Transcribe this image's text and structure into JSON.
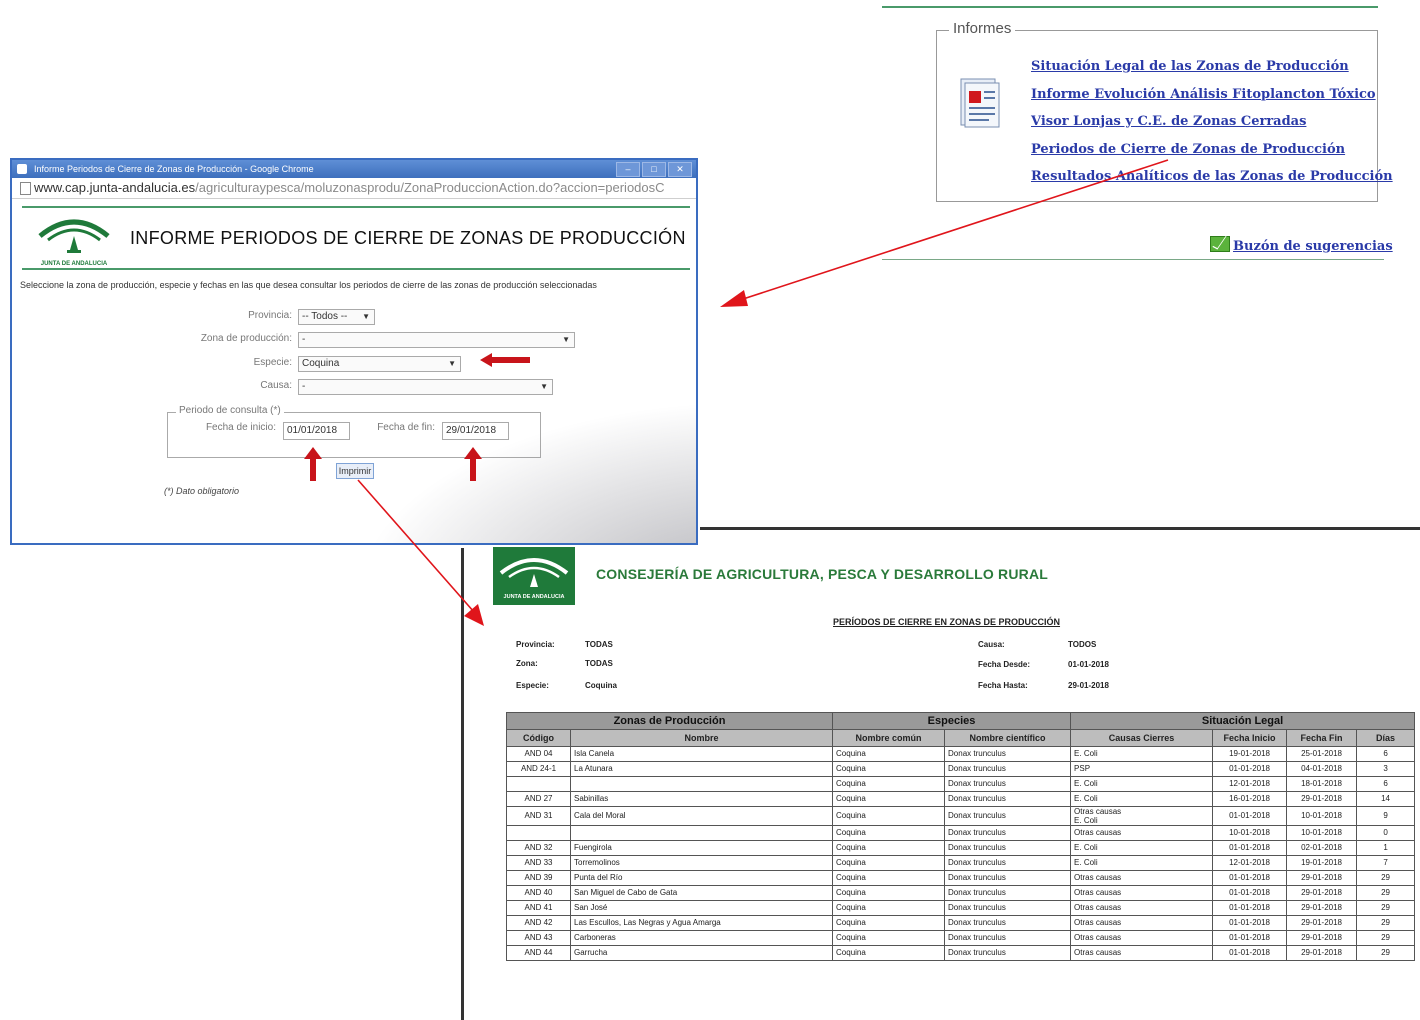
{
  "informes": {
    "legend": "Informes",
    "links": [
      "Situación Legal de las Zonas de Producción",
      "Informe Evolución Análisis Fitoplancton Tóxico",
      "Visor Lonjas y C.E. de Zonas Cerradas",
      "Periodos de Cierre de Zonas de Producción",
      "Resultados Analíticos de las Zonas de Producción"
    ],
    "buzon": "Buzón de sugerencias"
  },
  "browser": {
    "window_title": "Informe Periodos de Cierre de Zonas de Producción - Google Chrome",
    "url_host": "www.cap.junta-andalucia.es",
    "url_path": "/agriculturaypesca/moluzonasprodu/ZonaProduccionAction.do?accion=periodosC",
    "logo_text": "JUNTA DE ANDALUCIA",
    "app_title": "INFORME PERIODOS DE CIERRE DE ZONAS DE PRODUCCIÓN",
    "instructions": "Seleccione la zona de producción, especie y fechas en las que desea consultar los periodos de cierre de las zonas de producción seleccionadas",
    "provincia_label": "Provincia:",
    "provincia_value": "-- Todos --",
    "zona_label": "Zona de producción:",
    "zona_value": "-",
    "especie_label": "Especie:",
    "especie_value": "Coquina",
    "causa_label": "Causa:",
    "causa_value": "-",
    "periodo_legend": "Periodo de consulta (*)",
    "fecha_inicio_label": "Fecha de inicio:",
    "fecha_inicio_value": "01/01/2018",
    "fecha_fin_label": "Fecha de fin:",
    "fecha_fin_value": "29/01/2018",
    "imprimir_label": "Imprimir",
    "obligatorio": "(*) Dato obligatorio"
  },
  "report": {
    "logo_text": "JUNTA DE ANDALUCIA",
    "consejeria": "CONSEJERÍA DE AGRICULTURA, PESCA Y DESARROLLO RURAL",
    "title": "PERÍODOS DE CIERRE EN ZONAS DE PRODUCCIÓN",
    "meta": {
      "provincia_label": "Provincia:",
      "provincia_value": "TODAS",
      "zona_label": "Zona:",
      "zona_value": "TODAS",
      "especie_label": "Especie:",
      "especie_value": "Coquina",
      "causa_label": "Causa:",
      "causa_value": "TODOS",
      "desde_label": "Fecha Desde:",
      "desde_value": "01-01-2018",
      "hasta_label": "Fecha Hasta:",
      "hasta_value": "29-01-2018"
    },
    "groups": [
      "Zonas de Producción",
      "Especies",
      "Situación Legal"
    ],
    "columns": [
      "Código",
      "Nombre",
      "Nombre común",
      "Nombre científico",
      "Causas Cierres",
      "Fecha Inicio",
      "Fecha Fin",
      "Días"
    ],
    "rows": [
      [
        "AND 04",
        "Isla Canela",
        "Coquina",
        "Donax trunculus",
        "E. Coli",
        "19-01-2018",
        "25-01-2018",
        "6"
      ],
      [
        "AND 24-1",
        "La Atunara",
        "Coquina",
        "Donax trunculus",
        "PSP",
        "01-01-2018",
        "04-01-2018",
        "3"
      ],
      [
        "",
        "",
        "Coquina",
        "Donax trunculus",
        "E. Coli",
        "12-01-2018",
        "18-01-2018",
        "6"
      ],
      [
        "AND 27",
        "Sabinillas",
        "Coquina",
        "Donax trunculus",
        "E. Coli",
        "16-01-2018",
        "29-01-2018",
        "14"
      ],
      [
        "AND 31",
        "Cala del Moral",
        "Coquina",
        "Donax trunculus",
        "Otras causas\nE. Coli",
        "01-01-2018",
        "10-01-2018",
        "9"
      ],
      [
        "",
        "",
        "Coquina",
        "Donax trunculus",
        "Otras causas",
        "10-01-2018",
        "10-01-2018",
        "0"
      ],
      [
        "AND 32",
        "Fuengirola",
        "Coquina",
        "Donax trunculus",
        "E. Coli",
        "01-01-2018",
        "02-01-2018",
        "1"
      ],
      [
        "AND 33",
        "Torremolinos",
        "Coquina",
        "Donax trunculus",
        "E. Coli",
        "12-01-2018",
        "19-01-2018",
        "7"
      ],
      [
        "AND 39",
        "Punta del Río",
        "Coquina",
        "Donax trunculus",
        "Otras causas",
        "01-01-2018",
        "29-01-2018",
        "29"
      ],
      [
        "AND 40",
        "San Miguel de Cabo de Gata",
        "Coquina",
        "Donax trunculus",
        "Otras causas",
        "01-01-2018",
        "29-01-2018",
        "29"
      ],
      [
        "AND 41",
        "San José",
        "Coquina",
        "Donax trunculus",
        "Otras causas",
        "01-01-2018",
        "29-01-2018",
        "29"
      ],
      [
        "AND 42",
        "Las Escullos, Las Negras y Agua Amarga",
        "Coquina",
        "Donax trunculus",
        "Otras causas",
        "01-01-2018",
        "29-01-2018",
        "29"
      ],
      [
        "AND 43",
        "Carboneras",
        "Coquina",
        "Donax trunculus",
        "Otras causas",
        "01-01-2018",
        "29-01-2018",
        "29"
      ],
      [
        "AND 44",
        "Garrucha",
        "Coquina",
        "Donax trunculus",
        "Otras causas",
        "01-01-2018",
        "29-01-2018",
        "29"
      ]
    ]
  },
  "colors": {
    "link": "#2a3aa8",
    "brand_green": "#2a7a3a",
    "annotation_red": "#e0151b",
    "window_blue": "#3a6cc0"
  }
}
